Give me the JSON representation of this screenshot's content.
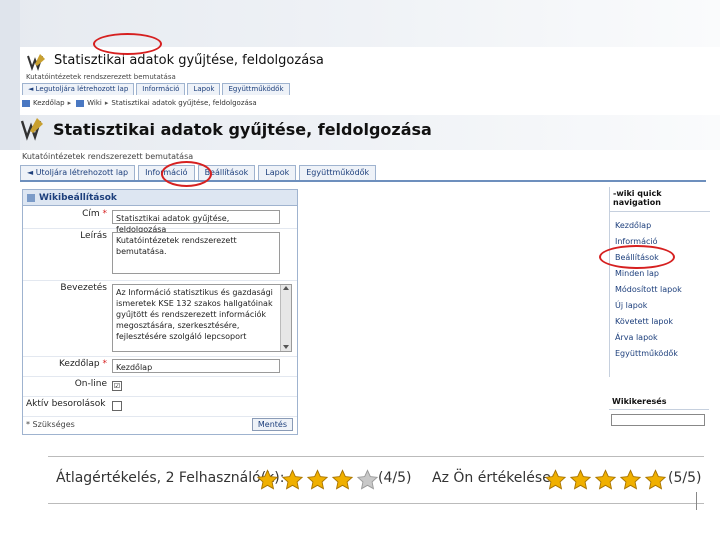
{
  "top_screenshot": {
    "title": "Statisztikai adatok gyűjtése, feldolgozása",
    "subtitle": "Kutatóintézetek rendszerezett bemutatása",
    "tabs": [
      "◄ Legutoljára létrehozott lap",
      "Információ",
      "Lapok",
      "Együttműködők"
    ],
    "breadcrumb": [
      "Kezdőlap",
      "Wiki",
      "Statisztikai adatok gyűjtése, feldolgozása"
    ]
  },
  "page": {
    "title": "Statisztikai adatok gyűjtése, feldolgozása",
    "subtitle": "Kutatóintézetek rendszerezett bemutatása",
    "tabs": [
      "◄ Utoljára létrehozott lap",
      "Információ",
      "Beállítások",
      "Lapok",
      "Együttműködők"
    ]
  },
  "settings": {
    "header": "Wikibeállítások",
    "fields": {
      "cim_label": "Cím",
      "cim_value": "Statisztikai adatok gyűjtése, feldolgozása",
      "leiras_label": "Leírás",
      "leiras_value": "Kutatóintézetek rendszerezett bemutatása.",
      "bevezetes_label": "Bevezetés",
      "bevezetes_value": "Az Információ statisztikus és gazdasági ismeretek KSE 132 szakos hallgatóinak gyűjtött és rendszerezett információk megosztására, szerkesztésére, fejlesztésére szolgáló lepcsoport",
      "kezdolap_label": "Kezdőlap",
      "kezdolap_value": "Kezdőlap",
      "online_label": "On-line",
      "online_checked": "☑",
      "aktiv_label": "Aktív besorolások",
      "aktiv_checked": ""
    },
    "required_mark": "*",
    "required_note": "* Szükséges",
    "save_label": "Mentés"
  },
  "sidebar": {
    "header": "wiki quick navigation",
    "items": [
      "Kezdőlap",
      "Információ",
      "Beállítások",
      "Minden lap",
      "Módosított lapok",
      "Új lapok",
      "Követett lapok",
      "Árva lapok",
      "Együttműködők"
    ]
  },
  "search": {
    "header": "Wikikeresés"
  },
  "rating": {
    "average_label": "Átlagértékelés, 2 Felhasználó(k):",
    "average_stars": 4,
    "average_score": "(4/5)",
    "yours_label": "Az Ön értékelése:",
    "yours_stars": 5,
    "yours_score": "(5/5)",
    "star_color": "#f0b000",
    "empty_star_color": "#c8c8c8"
  },
  "colors": {
    "highlight_circle": "#d62020",
    "link": "#1d3f7c"
  }
}
